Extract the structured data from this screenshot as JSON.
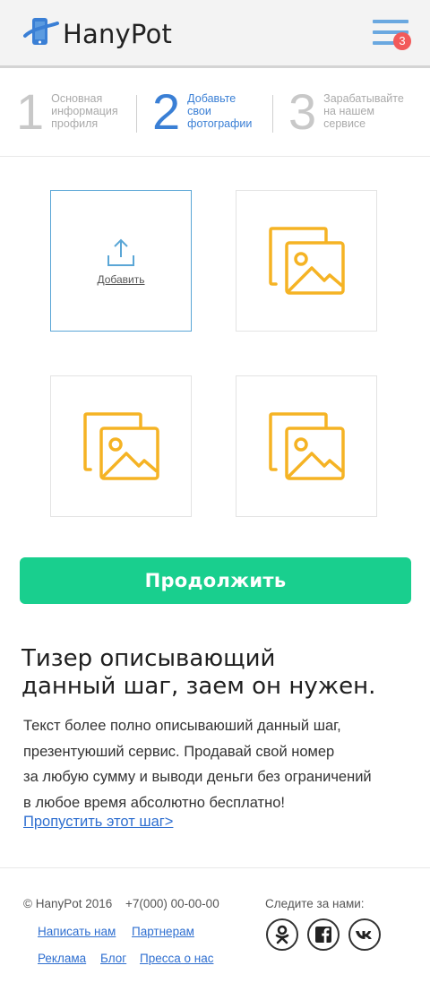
{
  "header": {
    "logo_text": "HanyPot",
    "menu_badge": "3"
  },
  "steps": [
    {
      "number": "1",
      "line1": "Основная",
      "line2": "информация",
      "line3": "профиля",
      "active": false
    },
    {
      "number": "2",
      "line1": "Добавьте",
      "line2": "свои",
      "line3": "фотографии",
      "active": true
    },
    {
      "number": "3",
      "line1": "Зарабатывайте",
      "line2": "на нашем",
      "line3": "сервисе",
      "active": false
    }
  ],
  "photos": {
    "add_label": "Добавить"
  },
  "continue_label": "Продолжить",
  "teaser": {
    "title_line1": "Тизер описывающий",
    "title_line2": "данный шаг, заем он нужен.",
    "text_line1": "Текст более полно описываюший данный шаг,",
    "text_line2": "презентуюший сервис. Продавай свой номер",
    "text_line3": "за любую сумму и выводи деньги без ограничений",
    "text_line4": "в любое время абсолютно бесплатно!",
    "skip_link": "Пропустить этот шаг>"
  },
  "footer": {
    "copyright": "© HanyPot 2016",
    "phone": "+7(000) 00-00-00",
    "links": [
      "Написать нам",
      "Партнерам",
      "Реклама",
      "Блог",
      "Пресса о нас"
    ],
    "follow_label": "Следите за нами:",
    "social": [
      "odnoklassniki-icon",
      "facebook-icon",
      "vk-icon"
    ]
  },
  "colors": {
    "accent_blue": "#3a7fd5",
    "button_green": "#19cf8e",
    "photo_icon": "#f5b324",
    "badge_red": "#f25a5a"
  }
}
